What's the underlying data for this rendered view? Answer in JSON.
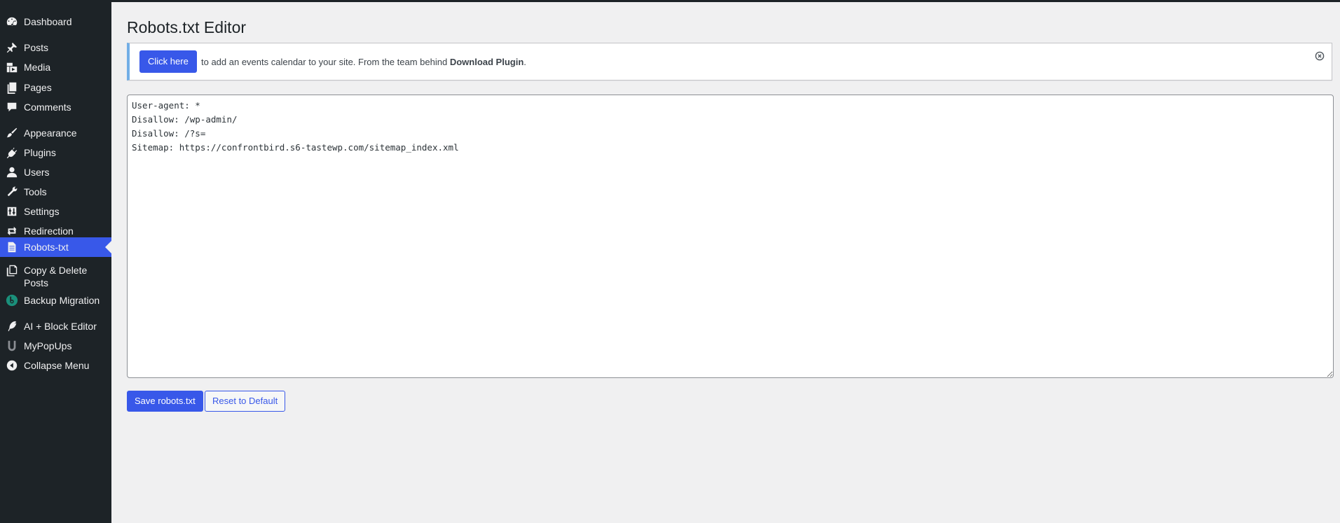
{
  "sidebar": {
    "items": [
      {
        "label": "Dashboard",
        "icon": "dashboard-icon"
      },
      {
        "label": "Posts",
        "icon": "pushpin-icon"
      },
      {
        "label": "Media",
        "icon": "media-icon"
      },
      {
        "label": "Pages",
        "icon": "pages-icon"
      },
      {
        "label": "Comments",
        "icon": "comment-icon"
      },
      {
        "label": "Appearance",
        "icon": "paintbrush-icon"
      },
      {
        "label": "Plugins",
        "icon": "plugin-icon"
      },
      {
        "label": "Users",
        "icon": "user-icon"
      },
      {
        "label": "Tools",
        "icon": "wrench-icon"
      },
      {
        "label": "Settings",
        "icon": "settings-icon"
      },
      {
        "label": "Redirection",
        "icon": "redirect-icon"
      },
      {
        "label": "Robots-txt",
        "icon": "document-icon",
        "active": true
      },
      {
        "label": "Copy & Delete Posts",
        "icon": "copy-icon"
      },
      {
        "label": "Backup Migration",
        "icon": "backup-icon"
      },
      {
        "label": "AI + Block Editor",
        "icon": "feather-icon"
      },
      {
        "label": "MyPopUps",
        "icon": "popup-u-icon"
      },
      {
        "label": "Collapse Menu",
        "icon": "collapse-arrow-icon"
      }
    ]
  },
  "page": {
    "title": "Robots.txt Editor"
  },
  "notice": {
    "button_label": "Click here",
    "text_before": "to add an events calendar to your site. From the team behind ",
    "text_bold": "Download Plugin",
    "text_after": "."
  },
  "editor": {
    "content": "User-agent: *\nDisallow: /wp-admin/\nDisallow: /?s=\nSitemap: https://confrontbird.s6-tastewp.com/sitemap_index.xml"
  },
  "actions": {
    "save_label": "Save robots.txt",
    "reset_label": "Reset to Default"
  },
  "colors": {
    "sidebar_bg": "#1d2327",
    "accent": "#3858e9",
    "page_bg": "#f0f0f1",
    "notice_border": "#72aee6"
  }
}
